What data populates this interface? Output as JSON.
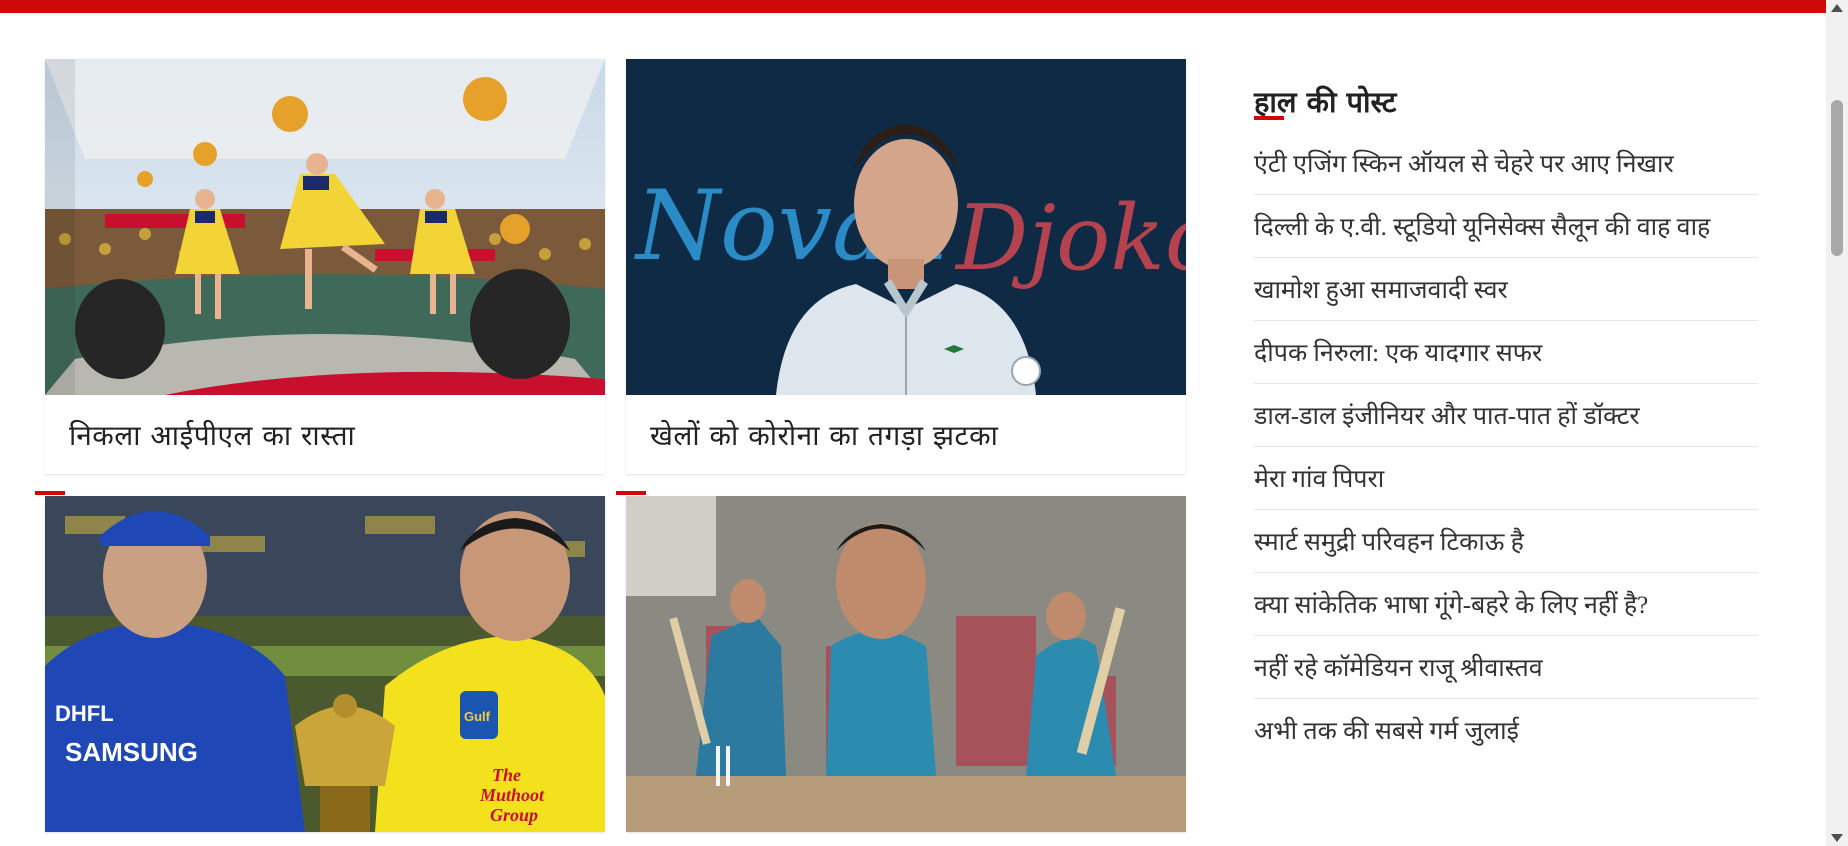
{
  "colors": {
    "accent": "#cc0a0a",
    "text": "#222222"
  },
  "cards": [
    {
      "title": "निकला आईपीएल का रास्ता",
      "image": "ipl-cheerleaders-photo"
    },
    {
      "title": "खेलों को कोरोना का तगड़ा झटका",
      "image": "novak-djokovic-photo",
      "image_text": {
        "left": "Novak",
        "right": "Djokovi"
      }
    },
    {
      "title": "",
      "image": "rohit-dhoni-trophy-photo"
    },
    {
      "title": "",
      "image": "virat-kohli-mural-photo"
    }
  ],
  "sidebar": {
    "title": "हाल की पोस्ट",
    "posts": [
      "एंटी एजिंग स्किन ऑयल से चेहरे पर आए निखार",
      "दिल्ली के ए.वी. स्टूडियो यूनिसेक्स सैलून की वाह वाह",
      "खामोश हुआ समाजवादी स्वर",
      "दीपक निरुला: एक यादगार सफर",
      "डाल-डाल इंजीनियर और पात-पात हों डॉक्टर",
      "मेरा गांव पिपरा",
      "स्मार्ट समुद्री परिवहन टिकाऊ है",
      "क्या सांकेतिक भाषा गूंगे-बहरे के लिए नहीं है?",
      "नहीं रहे कॉमेडियन राजू श्रीवास्तव",
      "अभी तक की सबसे गर्म जुलाई"
    ]
  }
}
